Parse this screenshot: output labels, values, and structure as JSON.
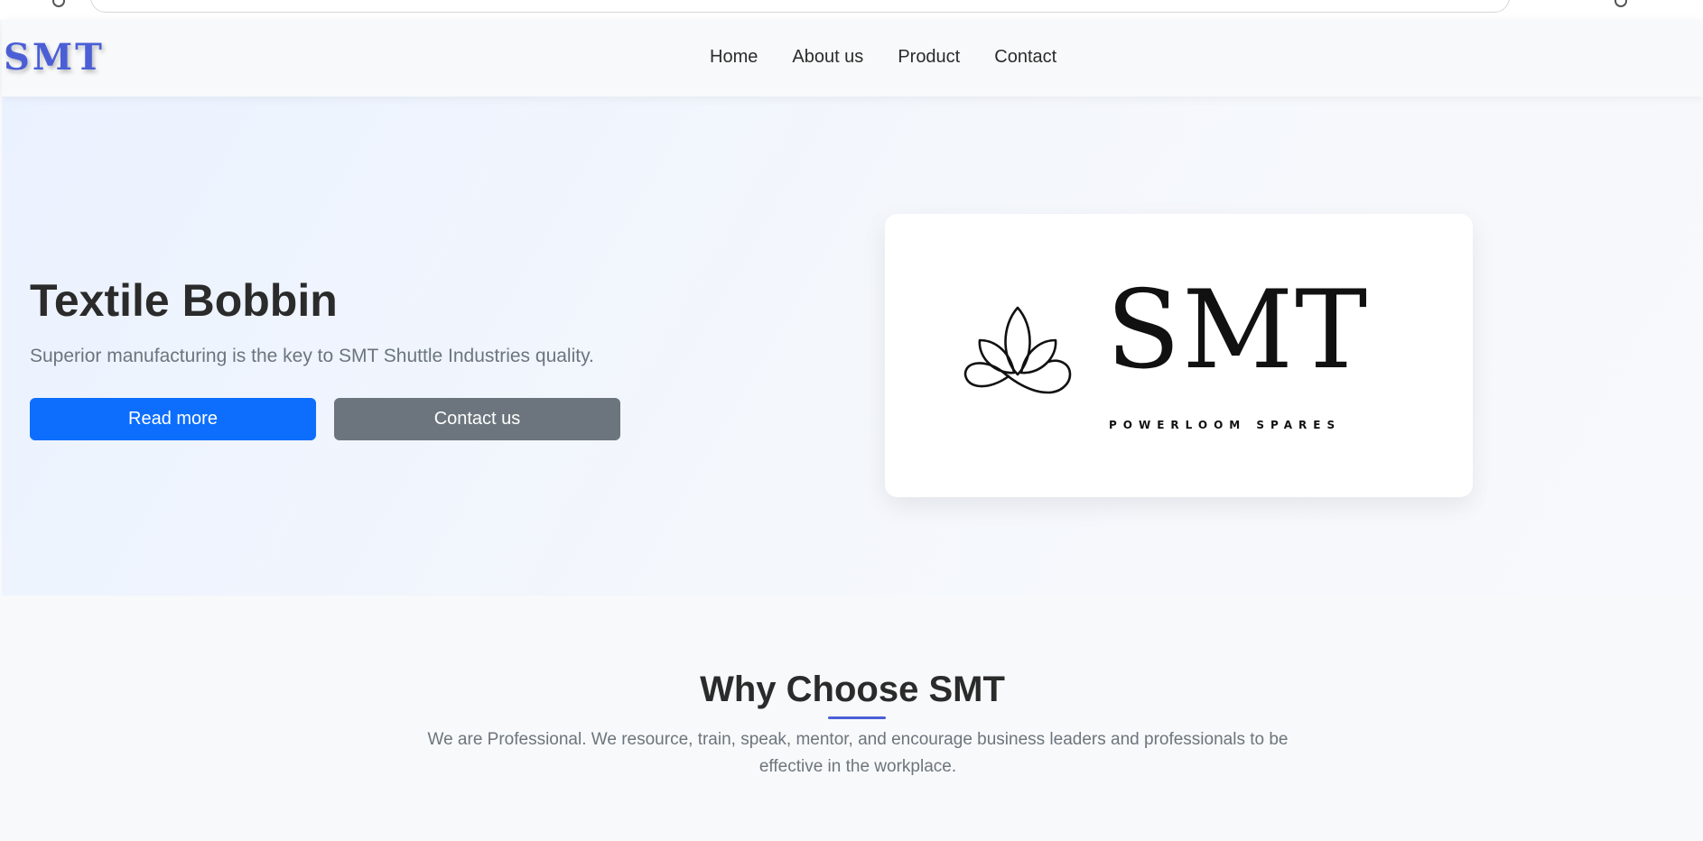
{
  "navbar": {
    "brand": "SMT",
    "links": [
      "Home",
      "About us",
      "Product",
      "Contact"
    ]
  },
  "hero": {
    "title": "Textile Bobbin",
    "subtitle": "Superior manufacturing is the key to SMT Shuttle Industries quality.",
    "primary_button": "Read more",
    "secondary_button": "Contact us",
    "logo": {
      "text": "SMT",
      "tagline": "POWERLOOM SPARES",
      "icon": "lotus-icon"
    }
  },
  "why": {
    "title": "Why Choose SMT",
    "text": "We are Professional. We resource, train, speak, mentor, and encourage business leaders and professionals to be effective in the workplace."
  },
  "colors": {
    "brand": "#4a5fd6",
    "primary": "#0d6efd",
    "secondary": "#6c757d",
    "text": "#2b2b2b"
  }
}
